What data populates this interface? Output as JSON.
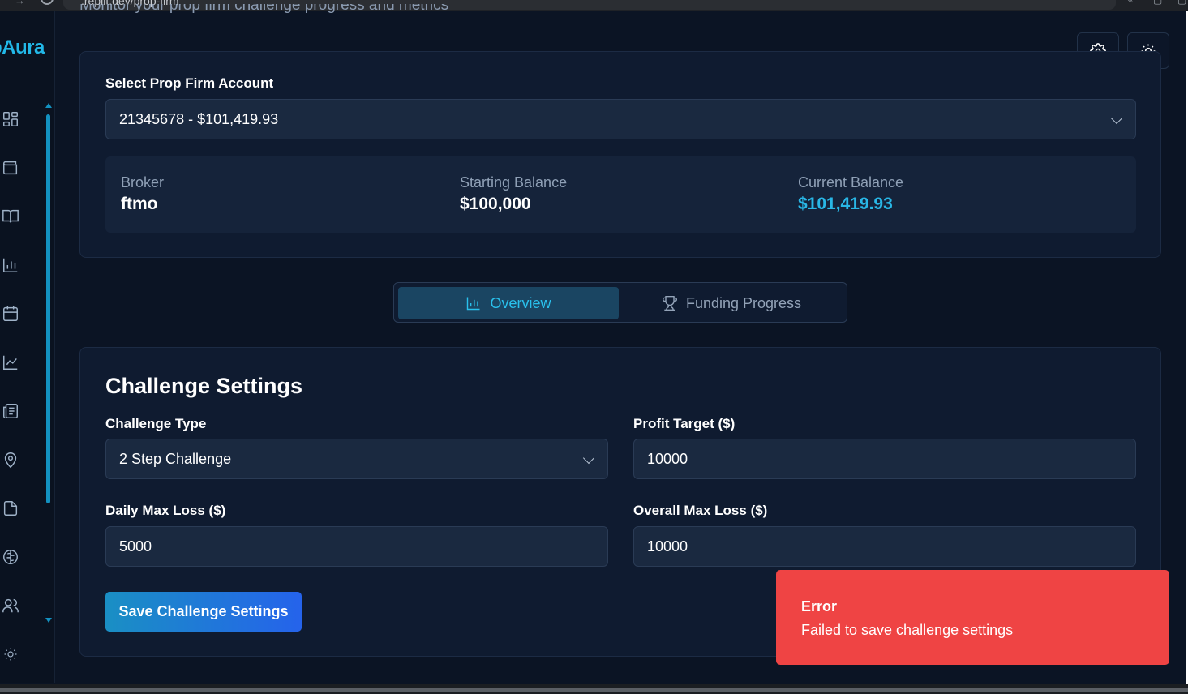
{
  "browser": {
    "url": ".replit.dev/prop-firm"
  },
  "sidebar": {
    "brand": "pAura",
    "icons": [
      "dashboard-icon",
      "wallet-icon",
      "book-icon",
      "bar-chart-icon",
      "calendar-icon",
      "line-chart-icon",
      "newspaper-icon",
      "map-pin-icon",
      "file-icon",
      "brain-icon",
      "users-icon",
      "sun-icon"
    ]
  },
  "header": {
    "subtitle": "Monitor your prop firm challenge progress and metrics",
    "settings_icon": "gear-icon",
    "theme_icon": "sun-icon"
  },
  "account": {
    "select_label": "Select Prop Firm Account",
    "selected": "21345678 - $101,419.93",
    "broker_label": "Broker",
    "broker_value": "ftmo",
    "starting_label": "Starting Balance",
    "starting_value": "$100,000",
    "current_label": "Current Balance",
    "current_value": "$101,419.93",
    "accent_color": "#29b7e6"
  },
  "tabs": [
    {
      "label": "Overview",
      "icon": "bar-chart-icon",
      "active": true
    },
    {
      "label": "Funding Progress",
      "icon": "trophy-icon",
      "active": false
    }
  ],
  "challenge": {
    "title": "Challenge Settings",
    "type_label": "Challenge Type",
    "type_value": "2 Step Challenge",
    "profit_label": "Profit Target ($)",
    "profit_value": "10000",
    "daily_label": "Daily Max Loss ($)",
    "daily_value": "5000",
    "overall_label": "Overall Max Loss ($)",
    "overall_value": "10000",
    "save_label": "Save Challenge Settings"
  },
  "toast": {
    "title": "Error",
    "message": "Failed to save challenge settings",
    "color": "#ef4444"
  }
}
